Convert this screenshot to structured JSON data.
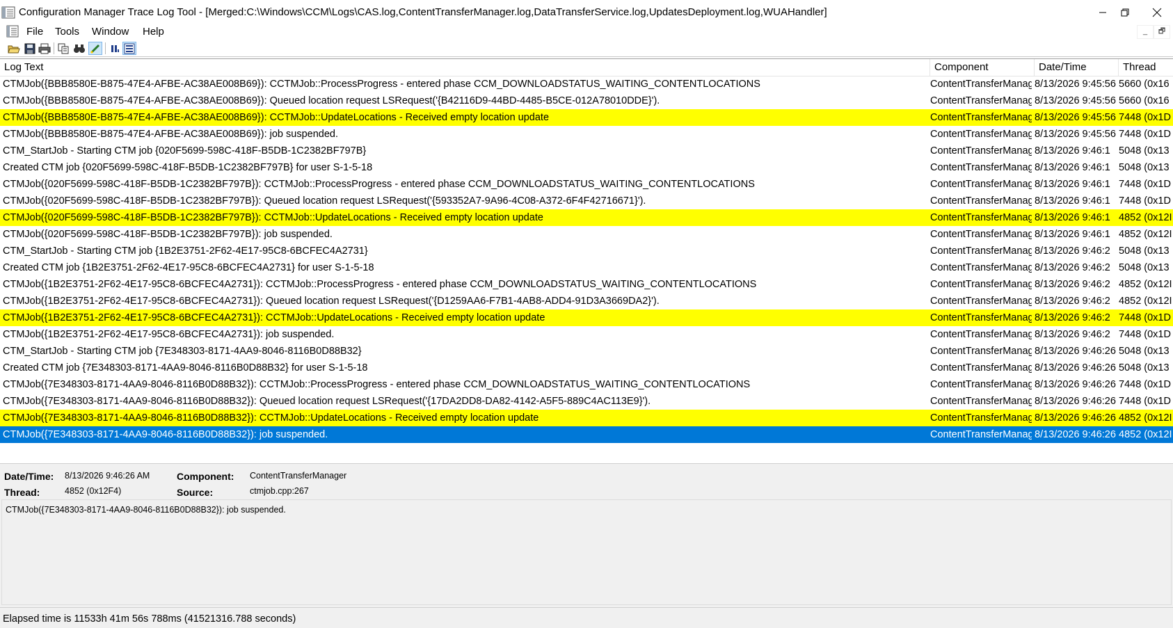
{
  "window": {
    "title": "Configuration Manager Trace Log Tool - [Merged:C:\\Windows\\CCM\\Logs\\CAS.log,ContentTransferManager.log,DataTransferService.log,UpdatesDeployment.log,WUAHandler]",
    "icon": "cmtrace-app-icon",
    "controls": [
      "minimize",
      "restore",
      "close"
    ]
  },
  "menu": {
    "file": "File",
    "tools": "Tools",
    "window": "Window",
    "help": "Help",
    "mdi_minimize": "_",
    "mdi_restore": "🗗"
  },
  "toolbar": [
    {
      "name": "open-icon"
    },
    {
      "name": "save-icon"
    },
    {
      "name": "print-icon"
    },
    {
      "name": "copy-icon"
    },
    {
      "name": "find-icon"
    },
    {
      "name": "highlight-icon",
      "active": true
    },
    {
      "name": "pause-icon"
    },
    {
      "name": "columns-icon"
    }
  ],
  "table": {
    "columns": [
      "Log Text",
      "Component",
      "Date/Time",
      "Thread"
    ],
    "rows": [
      {
        "text": "CTMJob({BBB8580E-B875-47E4-AFBE-AC38AE008B69}): CCTMJob::ProcessProgress - entered phase CCM_DOWNLOADSTATUS_WAITING_CONTENTLOCATIONS",
        "component": "ContentTransferManag",
        "datetime": "8/13/2026 9:45:56",
        "thread": "5660 (0x16",
        "style": "normal"
      },
      {
        "text": "CTMJob({BBB8580E-B875-47E4-AFBE-AC38AE008B69}): Queued location request LSRequest('{B42116D9-44BD-4485-B5CE-012A78010DDE}').",
        "component": "ContentTransferManag",
        "datetime": "8/13/2026 9:45:56",
        "thread": "5660 (0x16",
        "style": "normal"
      },
      {
        "text": "CTMJob({BBB8580E-B875-47E4-AFBE-AC38AE008B69}): CCTMJob::UpdateLocations - Received empty location update",
        "component": "ContentTransferManag",
        "datetime": "8/13/2026 9:45:56",
        "thread": "7448 (0x1D",
        "style": "highlight"
      },
      {
        "text": "CTMJob({BBB8580E-B875-47E4-AFBE-AC38AE008B69}): job suspended.",
        "component": "ContentTransferManag",
        "datetime": "8/13/2026 9:45:56",
        "thread": "7448 (0x1D",
        "style": "normal"
      },
      {
        "text": "CTM_StartJob - Starting CTM job {020F5699-598C-418F-B5DB-1C2382BF797B}",
        "component": "ContentTransferManag",
        "datetime": "8/13/2026 9:46:1",
        "thread": "5048 (0x13",
        "style": "normal"
      },
      {
        "text": "Created CTM job {020F5699-598C-418F-B5DB-1C2382BF797B} for user S-1-5-18",
        "component": "ContentTransferManag",
        "datetime": "8/13/2026 9:46:1",
        "thread": "5048 (0x13",
        "style": "normal"
      },
      {
        "text": "CTMJob({020F5699-598C-418F-B5DB-1C2382BF797B}): CCTMJob::ProcessProgress - entered phase CCM_DOWNLOADSTATUS_WAITING_CONTENTLOCATIONS",
        "component": "ContentTransferManag",
        "datetime": "8/13/2026 9:46:1",
        "thread": "7448 (0x1D",
        "style": "normal"
      },
      {
        "text": "CTMJob({020F5699-598C-418F-B5DB-1C2382BF797B}): Queued location request LSRequest('{593352A7-9A96-4C08-A372-6F4F42716671}').",
        "component": "ContentTransferManag",
        "datetime": "8/13/2026 9:46:1",
        "thread": "7448 (0x1D",
        "style": "normal"
      },
      {
        "text": "CTMJob({020F5699-598C-418F-B5DB-1C2382BF797B}): CCTMJob::UpdateLocations - Received empty location update",
        "component": "ContentTransferManag",
        "datetime": "8/13/2026 9:46:1",
        "thread": "4852 (0x12I",
        "style": "highlight"
      },
      {
        "text": "CTMJob({020F5699-598C-418F-B5DB-1C2382BF797B}): job suspended.",
        "component": "ContentTransferManag",
        "datetime": "8/13/2026 9:46:1",
        "thread": "4852 (0x12I",
        "style": "normal"
      },
      {
        "text": "CTM_StartJob - Starting CTM job {1B2E3751-2F62-4E17-95C8-6BCFEC4A2731}",
        "component": "ContentTransferManag",
        "datetime": "8/13/2026 9:46:2",
        "thread": "5048 (0x13",
        "style": "normal"
      },
      {
        "text": "Created CTM job {1B2E3751-2F62-4E17-95C8-6BCFEC4A2731} for user S-1-5-18",
        "component": "ContentTransferManag",
        "datetime": "8/13/2026 9:46:2",
        "thread": "5048 (0x13",
        "style": "normal"
      },
      {
        "text": "CTMJob({1B2E3751-2F62-4E17-95C8-6BCFEC4A2731}): CCTMJob::ProcessProgress - entered phase CCM_DOWNLOADSTATUS_WAITING_CONTENTLOCATIONS",
        "component": "ContentTransferManag",
        "datetime": "8/13/2026 9:46:2",
        "thread": "4852 (0x12I",
        "style": "normal"
      },
      {
        "text": "CTMJob({1B2E3751-2F62-4E17-95C8-6BCFEC4A2731}): Queued location request LSRequest('{D1259AA6-F7B1-4AB8-ADD4-91D3A3669DA2}').",
        "component": "ContentTransferManag",
        "datetime": "8/13/2026 9:46:2",
        "thread": "4852 (0x12I",
        "style": "normal"
      },
      {
        "text": "CTMJob({1B2E3751-2F62-4E17-95C8-6BCFEC4A2731}): CCTMJob::UpdateLocations - Received empty location update",
        "component": "ContentTransferManag",
        "datetime": "8/13/2026 9:46:2",
        "thread": "7448 (0x1D",
        "style": "highlight"
      },
      {
        "text": "CTMJob({1B2E3751-2F62-4E17-95C8-6BCFEC4A2731}): job suspended.",
        "component": "ContentTransferManag",
        "datetime": "8/13/2026 9:46:2",
        "thread": "7448 (0x1D",
        "style": "normal"
      },
      {
        "text": "CTM_StartJob - Starting CTM job {7E348303-8171-4AA9-8046-8116B0D88B32}",
        "component": "ContentTransferManag",
        "datetime": "8/13/2026 9:46:26",
        "thread": "5048 (0x13",
        "style": "normal"
      },
      {
        "text": "Created CTM job {7E348303-8171-4AA9-8046-8116B0D88B32} for user S-1-5-18",
        "component": "ContentTransferManag",
        "datetime": "8/13/2026 9:46:26",
        "thread": "5048 (0x13",
        "style": "normal"
      },
      {
        "text": "CTMJob({7E348303-8171-4AA9-8046-8116B0D88B32}): CCTMJob::ProcessProgress - entered phase CCM_DOWNLOADSTATUS_WAITING_CONTENTLOCATIONS",
        "component": "ContentTransferManag",
        "datetime": "8/13/2026 9:46:26",
        "thread": "7448 (0x1D",
        "style": "normal"
      },
      {
        "text": "CTMJob({7E348303-8171-4AA9-8046-8116B0D88B32}): Queued location request LSRequest('{17DA2DD8-DA82-4142-A5F5-889C4AC113E9}').",
        "component": "ContentTransferManag",
        "datetime": "8/13/2026 9:46:26",
        "thread": "7448 (0x1D",
        "style": "normal"
      },
      {
        "text": "CTMJob({7E348303-8171-4AA9-8046-8116B0D88B32}): CCTMJob::UpdateLocations - Received empty location update",
        "component": "ContentTransferManag",
        "datetime": "8/13/2026 9:46:26",
        "thread": "4852 (0x12I",
        "style": "highlight"
      },
      {
        "text": "CTMJob({7E348303-8171-4AA9-8046-8116B0D88B32}): job suspended.",
        "component": "ContentTransferManag",
        "datetime": "8/13/2026 9:46:26",
        "thread": "4852 (0x12I",
        "style": "selected"
      }
    ]
  },
  "details": {
    "datetime_label": "Date/Time:",
    "datetime_value": "8/13/2026 9:46:26 AM",
    "component_label": "Component:",
    "component_value": "ContentTransferManager",
    "thread_label": "Thread:",
    "thread_value": "4852 (0x12F4)",
    "source_label": "Source:",
    "source_value": "ctmjob.cpp:267",
    "message": "CTMJob({7E348303-8171-4AA9-8046-8116B0D88B32}): job suspended."
  },
  "status": {
    "text": "Elapsed time is 11533h 41m 56s 788ms (41521316.788 seconds)"
  },
  "colors": {
    "highlight": "#ffff00",
    "selected": "#0078d7",
    "pane_bg": "#f0f0f0"
  }
}
